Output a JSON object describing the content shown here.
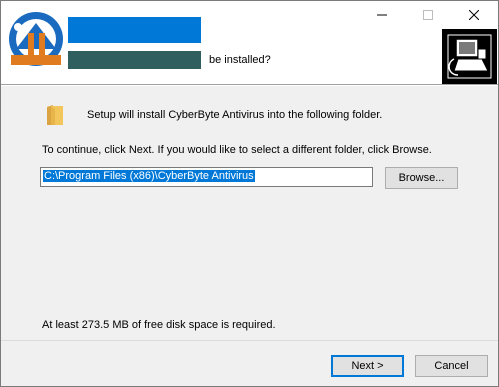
{
  "header": {
    "subtitle_suffix": "be installed?",
    "caption_buttons": {
      "minimize_icon": "minimize-icon",
      "maximize_icon": "maximize-icon",
      "close_icon": "close-icon"
    }
  },
  "body": {
    "intro": "Setup will install CyberByte Antivirus into the following folder.",
    "continue": "To continue, click Next. If you would like to select a different folder, click Browse.",
    "install_path": "C:\\Program Files (x86)\\CyberByte Antivirus",
    "browse_label": "Browse...",
    "disk_space": "At least 273.5 MB of free disk space is required."
  },
  "footer": {
    "next_label": "Next >",
    "cancel_label": "Cancel"
  },
  "colors": {
    "accent": "#0078d7",
    "subtitle_redaction": "#2f5f5f",
    "window_bg": "#f0f0f0"
  }
}
